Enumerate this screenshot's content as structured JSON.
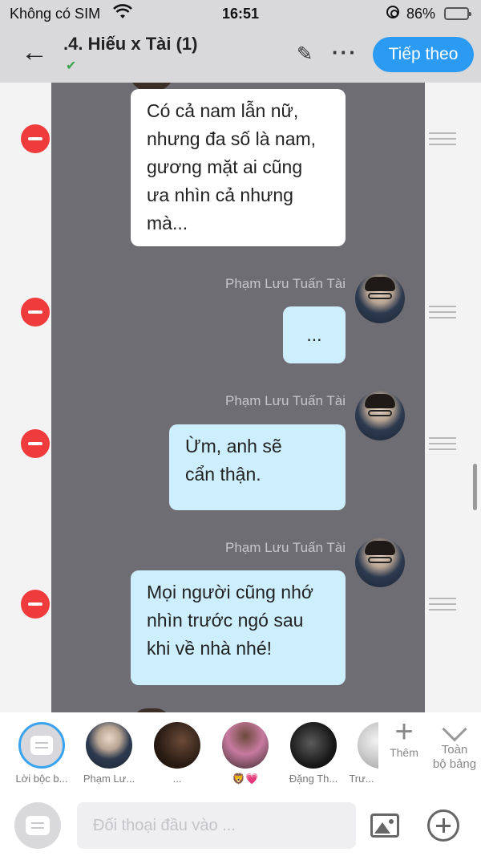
{
  "status_bar": {
    "carrier": "Không có SIM",
    "time": "16:51",
    "battery": "86%",
    "battery_level": 0.86
  },
  "header": {
    "title": ".4. Hiếu x Tài (1)",
    "next_label": "Tiếp theo"
  },
  "messages": [
    {
      "side": "left",
      "text_lines": [
        "Có cả nam lẫn nữ,",
        "nhưng đa số là nam,",
        "gương mặt ai cũng",
        "ưa nhìn cả nhưng",
        "mà..."
      ]
    },
    {
      "side": "right",
      "sender": "Phạm Lưu Tuấn Tài",
      "text_lines": [
        "..."
      ]
    },
    {
      "side": "right",
      "sender": "Phạm Lưu Tuấn Tài",
      "text_lines": [
        "Ừm, anh sẽ",
        "cẩn thận."
      ]
    },
    {
      "side": "right",
      "sender": "Phạm Lưu Tuấn Tài",
      "text_lines": [
        "Mọi người cũng nhớ",
        "nhìn trước ngó sau",
        "khi về nhà nhé!"
      ]
    }
  ],
  "characters": [
    {
      "name": "Lời bộc b..."
    },
    {
      "name": "Phạm Lư..."
    },
    {
      "name": "..."
    },
    {
      "name": "🦁💗"
    },
    {
      "name": "Đặng Th..."
    },
    {
      "name": "Trư..."
    }
  ],
  "more_label": "Thêm",
  "all_label_line1": "Toàn",
  "all_label_line2": "bộ bảng",
  "input": {
    "placeholder": "Đối thoại đầu vào ..."
  },
  "colors": {
    "accent": "#2b9af3",
    "panel": "#6e6d73",
    "bubble_right": "#cdeefd",
    "remove": "#ef3b3b"
  }
}
